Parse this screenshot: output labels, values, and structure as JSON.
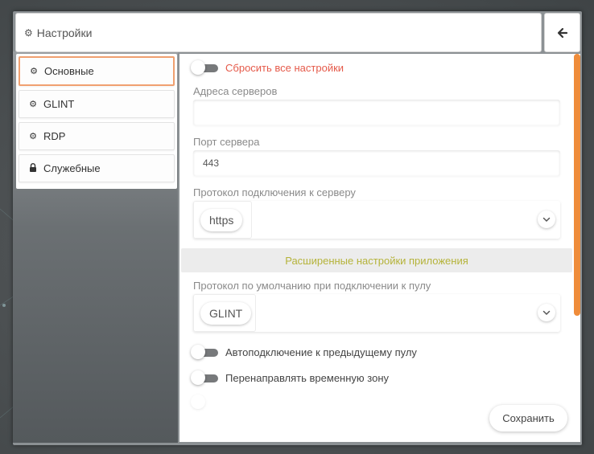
{
  "header": {
    "title": "Настройки",
    "gear_icon": "gear-icon",
    "back_icon": "arrow-left-icon"
  },
  "sidebar": {
    "items": [
      {
        "label": "Основные",
        "icon": "gear-icon",
        "active": true
      },
      {
        "label": "GLINT",
        "icon": "gear-icon",
        "active": false
      },
      {
        "label": "RDP",
        "icon": "gear-icon",
        "active": false
      },
      {
        "label": "Служебные",
        "icon": "lock-icon",
        "active": false
      }
    ]
  },
  "main": {
    "reset_toggle": {
      "label": "Сбросить все настройки",
      "on": false
    },
    "servers": {
      "label": "Адреса серверов",
      "value": ""
    },
    "port": {
      "label": "Порт сервера",
      "value": "443"
    },
    "protocol": {
      "label": "Протокол подключения к серверу",
      "value": "https"
    },
    "advanced_section": "Расширенные настройки приложения",
    "default_protocol": {
      "label": "Протокол по умолчанию при подключении к пулу",
      "value": "GLINT"
    },
    "autoconnect_toggle": {
      "label": "Автоподключение к предыдущему пулу",
      "on": false
    },
    "timezone_toggle": {
      "label": "Перенаправлять временную зону",
      "on": false
    },
    "save_label": "Сохранить"
  },
  "colors": {
    "accent": "#ef8c3a",
    "danger": "#e55a4a",
    "section_text": "#b5b33a",
    "active_border": "#f0a070"
  }
}
